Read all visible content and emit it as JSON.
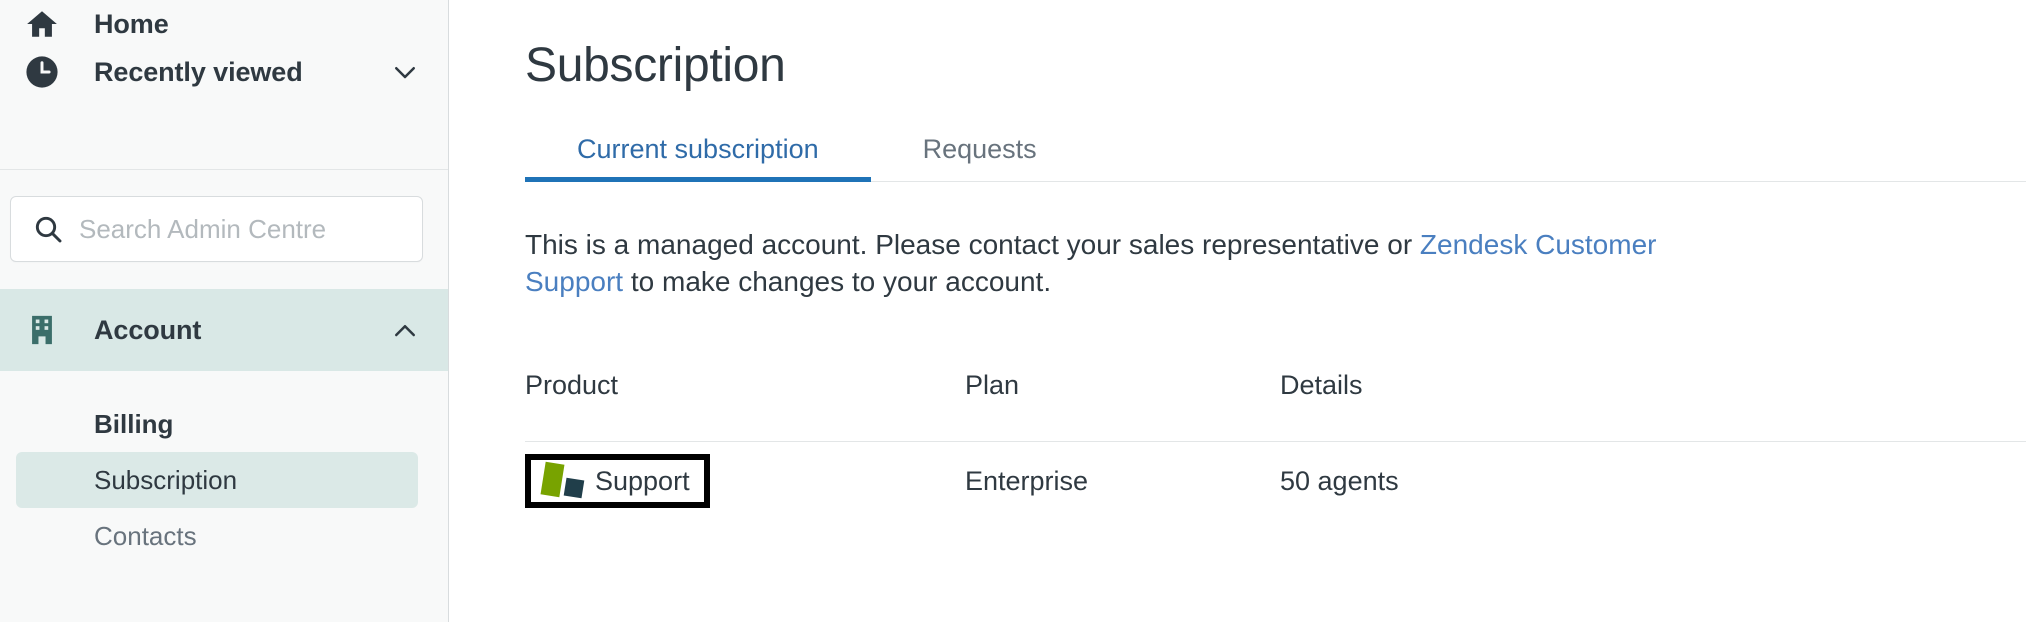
{
  "sidebar": {
    "top_items": [
      {
        "label": "Home",
        "icon": "home-icon",
        "has_chevron": false
      },
      {
        "label": "Recently viewed",
        "icon": "clock-icon",
        "has_chevron": true,
        "chevron": "chevron-down-icon"
      }
    ],
    "search": {
      "placeholder": "Search Admin Centre",
      "value": "",
      "icon": "search-icon"
    },
    "account": {
      "label": "Account",
      "icon": "building-icon",
      "chevron": "chevron-up-icon",
      "expanded": true,
      "sub_items": [
        {
          "label": "Billing",
          "state": "header"
        },
        {
          "label": "Subscription",
          "state": "selected"
        },
        {
          "label": "Contacts",
          "state": "normal"
        }
      ]
    }
  },
  "main": {
    "title": "Subscription",
    "tabs": [
      {
        "label": "Current subscription",
        "active": true
      },
      {
        "label": "Requests",
        "active": false
      }
    ],
    "notice": {
      "part1": "This is a managed account. Please contact your sales representative or ",
      "link": "Zendesk Customer Support",
      "part2": " to make changes to your account."
    },
    "table": {
      "headers": {
        "product": "Product",
        "plan": "Plan",
        "details": "Details"
      },
      "rows": [
        {
          "product": "Support",
          "product_icon": "zendesk-support-logo",
          "plan": "Enterprise",
          "details": "50 agents",
          "focused": true
        }
      ]
    }
  },
  "colors": {
    "accent_link": "#1f73b7",
    "tab_active": "#2f6ba8",
    "sidebar_bg": "#f8f9f9",
    "account_highlight": "#d9e8e6",
    "selected_item": "#dbe9e7",
    "text": "#2f3941",
    "muted_text": "#68737d",
    "zendesk_green": "#78a300",
    "zendesk_dark": "#203e4a",
    "focus_border": "#000000"
  }
}
